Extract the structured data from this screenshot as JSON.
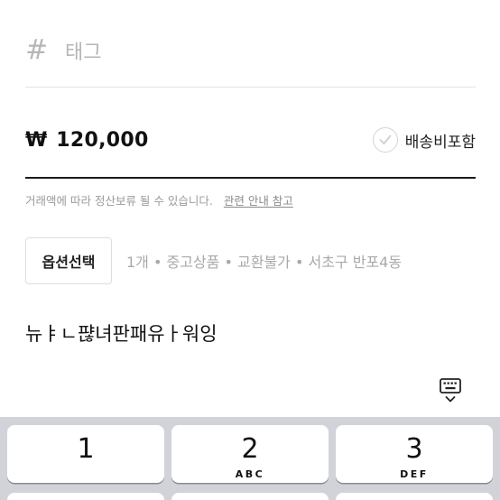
{
  "tag": {
    "icon": "hash-icon",
    "hash_symbol": "#",
    "placeholder": "태그"
  },
  "price": {
    "currency_symbol": "₩",
    "value": "120,000",
    "shipping_included_label": "배송비포함",
    "shipping_included_checked": false,
    "check_icon": "check-circle-icon"
  },
  "notice": {
    "text": "거래액에 따라 정산보류 될 수 있습니다.",
    "link_label": "관련 안내 참고"
  },
  "options": {
    "button_label": "옵션선택",
    "summary": "1개 • 중고상품 • 교환불가 • 서초구 반포4동"
  },
  "description": {
    "text": "뉴ㅑㄴ퍊녀판패유ㅏ워잉"
  },
  "keyboard_toggle": {
    "icon": "keyboard-dismiss-icon"
  },
  "keypad": {
    "keys": [
      {
        "num": "1",
        "letters": ""
      },
      {
        "num": "2",
        "letters": "ABC"
      },
      {
        "num": "3",
        "letters": "DEF"
      }
    ]
  },
  "colors": {
    "keyboard_bg": "#d1d3d9",
    "placeholder": "#b6b6b6",
    "muted_text": "#a9a9a9"
  }
}
